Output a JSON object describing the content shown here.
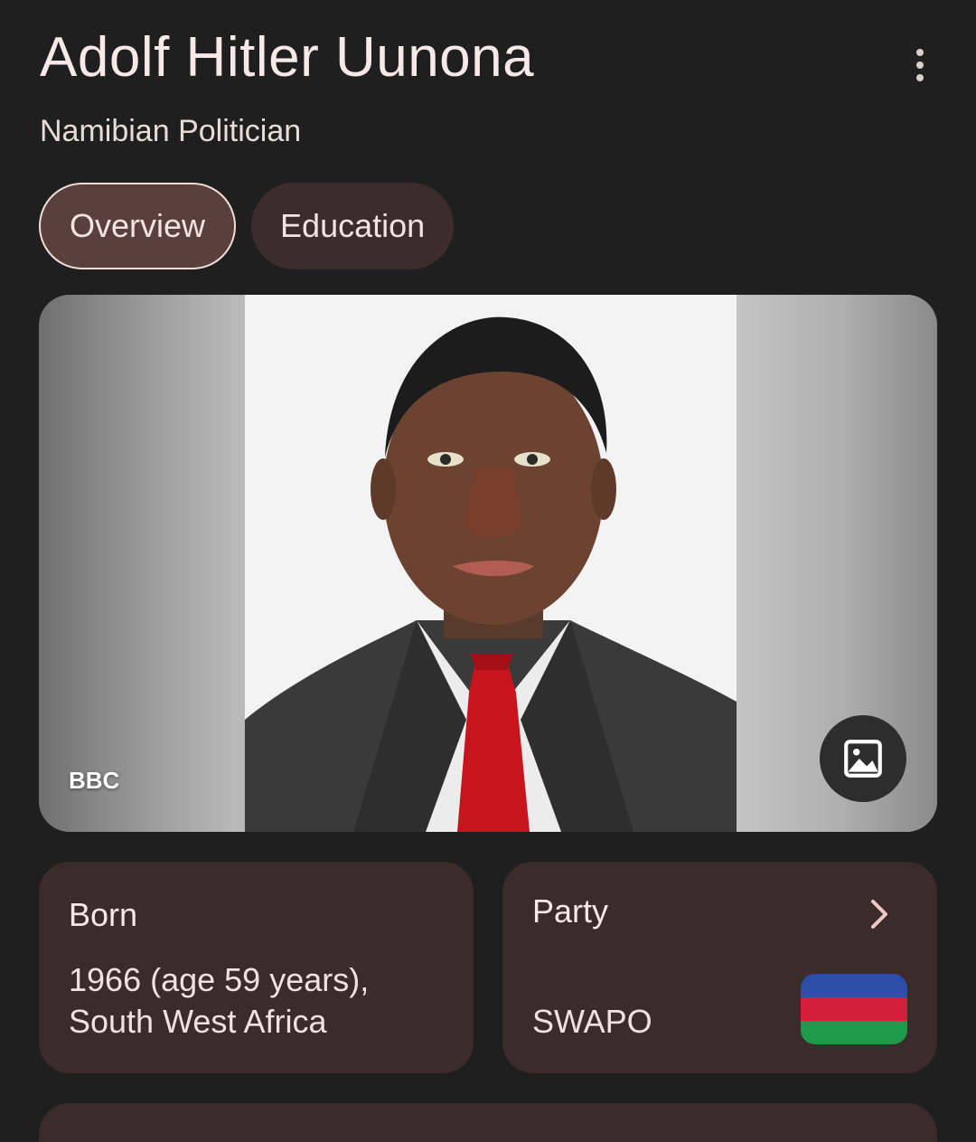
{
  "header": {
    "title": "Adolf Hitler Uunona",
    "subtitle": "Namibian Politician",
    "menu_icon": "more-vert-icon"
  },
  "tabs": [
    {
      "label": "Overview",
      "selected": true
    },
    {
      "label": "Education",
      "selected": false
    }
  ],
  "image": {
    "source": "BBC",
    "button_icon": "image-icon"
  },
  "facts": {
    "born": {
      "label": "Born",
      "line1": "1966 (age 59 years),",
      "line2": "South West Africa"
    },
    "party": {
      "label": "Party",
      "value": "SWAPO",
      "icon": "chevron-right-icon",
      "flag_colors": [
        "#2b4fa8",
        "#d21f3c",
        "#1f9a4a"
      ]
    }
  },
  "colors": {
    "background": "#1f1f1f",
    "card": "#3b2b2b",
    "chip_active": "#5a403d",
    "chip": "#3c2c2c"
  }
}
